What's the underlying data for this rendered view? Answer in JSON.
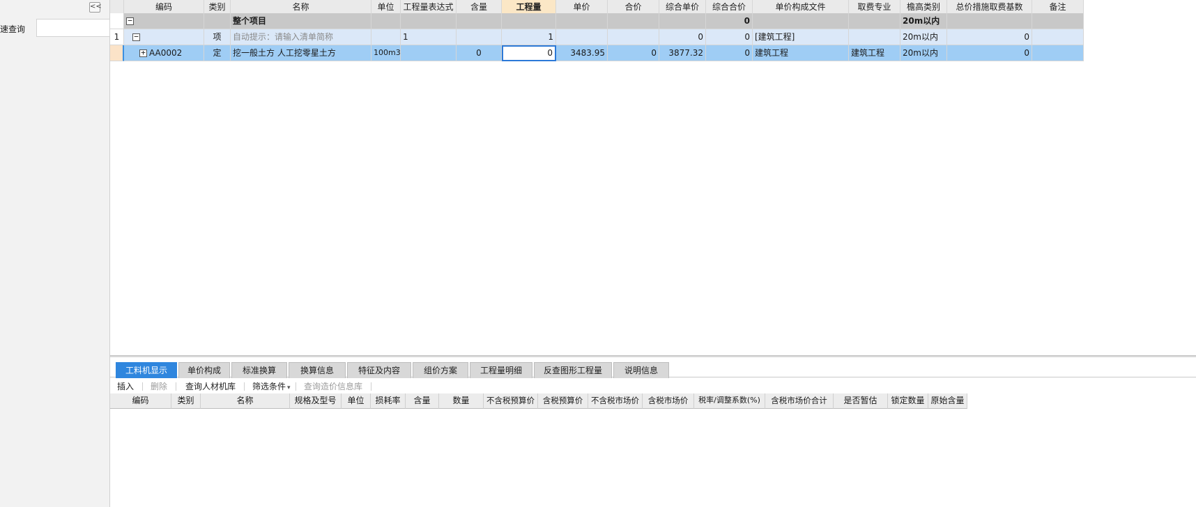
{
  "left_panel": {
    "collapse_icon": "double-chevron-left-icon",
    "collapse_glyph": "<<",
    "quick_search_label": "速查询"
  },
  "grid": {
    "headers": [
      "编码",
      "类别",
      "名称",
      "单位",
      "工程量表达式",
      "含量",
      "工程量",
      "单价",
      "合价",
      "综合单价",
      "综合合价",
      "单价构成文件",
      "取费专业",
      "檐高类别",
      "总价措施取费基数",
      "备注"
    ],
    "active_header": "工程量",
    "rows": [
      {
        "tree_glyph": "−",
        "name": "整个项目",
        "comp_total": "0",
        "eave": "20m以内"
      },
      {
        "num": "1",
        "tree_glyph": "−",
        "type": "项",
        "name": "自动提示：请输入清单简称",
        "expr": "1",
        "qty": "1",
        "comp_price": "0",
        "comp_total": "0",
        "file": "[建筑工程]",
        "eave": "20m以内",
        "base": "0"
      },
      {
        "tree_glyph": "+",
        "code": "AA0002",
        "type": "定",
        "name": "挖一般土方 人工挖零星土方",
        "unit": "100m3",
        "content": "0",
        "qty": "0",
        "price": "3483.95",
        "total": "0",
        "comp_price": "3877.32",
        "comp_total": "0",
        "file": "建筑工程",
        "fee": "建筑工程",
        "eave": "20m以内",
        "base": "0"
      }
    ]
  },
  "bottom": {
    "tabs": [
      "工料机显示",
      "单价构成",
      "标准换算",
      "换算信息",
      "特征及内容",
      "组价方案",
      "工程量明细",
      "反查图形工程量",
      "说明信息"
    ],
    "active_tab": "工料机显示",
    "toolbar": {
      "insert": "插入",
      "delete": "删除",
      "query_lib": "查询人材机库",
      "filter": "筛选条件",
      "filter_arrow": "▾",
      "query_price": "查询造价信息库"
    },
    "sub_headers": [
      "编码",
      "类别",
      "名称",
      "规格及型号",
      "单位",
      "损耗率",
      "含量",
      "数量",
      "不含税预算价",
      "含税预算价",
      "不含税市场价",
      "含税市场价",
      "税率/调整系数(%)",
      "含税市场价合计",
      "是否暂估",
      "锁定数量",
      "原始含量"
    ]
  },
  "colors": {
    "active_tab": "#2f86de",
    "selected_row": "#9fcdf5",
    "parent_row": "#dbe8f8",
    "project_row": "#c8c8c8",
    "active_header": "#fbe7c6"
  }
}
